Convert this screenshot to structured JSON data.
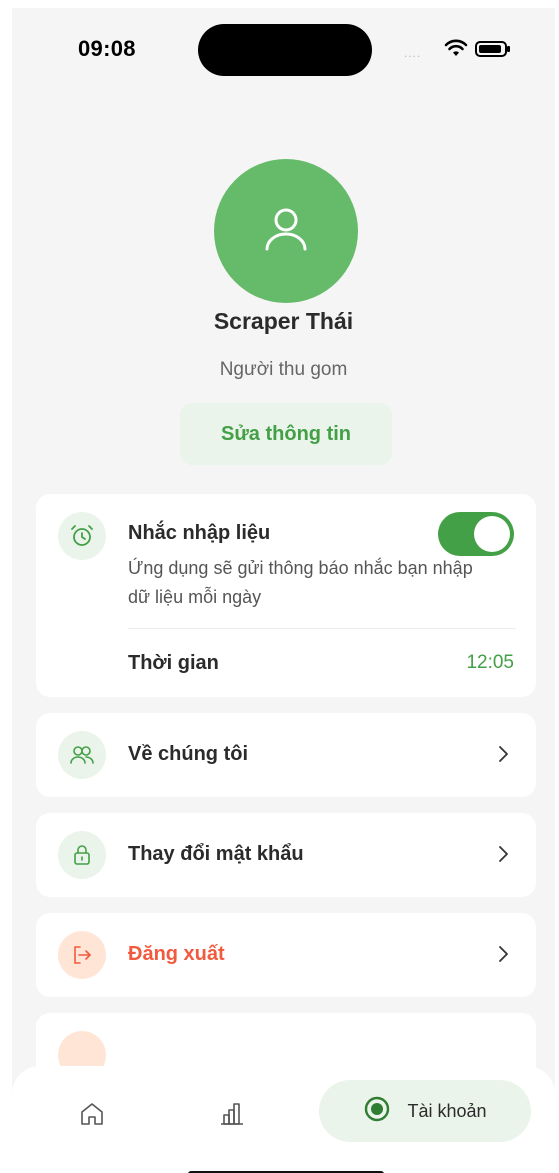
{
  "status_bar": {
    "time": "09:08",
    "signal": "....",
    "wifi_icon": "wifi-icon",
    "battery_icon": "battery-icon"
  },
  "profile": {
    "avatar_icon": "user-icon",
    "name": "Scraper Thái",
    "role": "Người thu gom",
    "edit_label": "Sửa thông tin"
  },
  "reminder": {
    "icon": "alarm-clock-icon",
    "title": "Nhắc nhập liệu",
    "description": "Ứng dụng sẽ gửi thông báo nhắc bạn nhập dữ liệu mỗi ngày",
    "enabled": true,
    "time_label": "Thời gian",
    "time_value": "12:05"
  },
  "menu": [
    {
      "label": "Về chúng tôi",
      "icon": "users-icon"
    },
    {
      "label": "Thay đổi mật khẩu",
      "icon": "lock-icon"
    },
    {
      "label": "Đăng xuất",
      "icon": "logout-icon"
    }
  ],
  "bottom_nav": {
    "home_icon": "home-icon",
    "stats_icon": "bar-chart-icon",
    "account_label": "Tài khoản",
    "account_icon": "account-circle-icon"
  },
  "colors": {
    "primary": "#43a047",
    "avatar": "#66bb6a",
    "danger": "#f15a3e",
    "tint": "#eaf4ea"
  }
}
